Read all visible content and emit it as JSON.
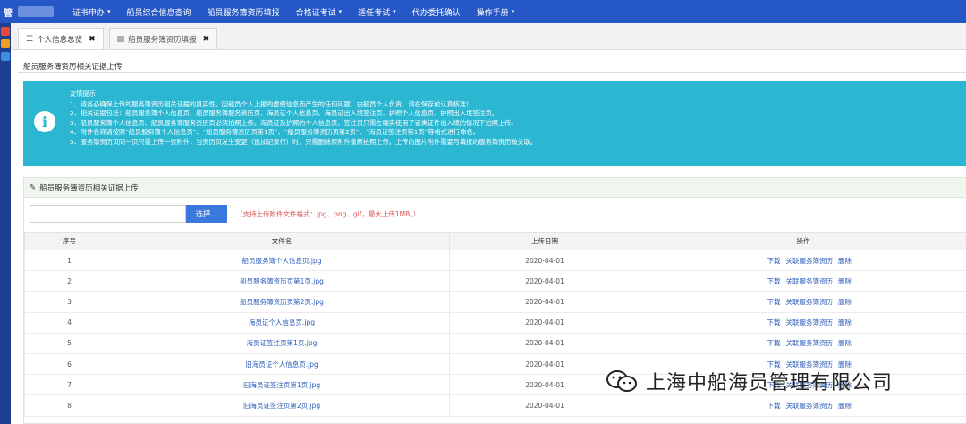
{
  "topbar": {
    "brand_char": "管",
    "nav": [
      {
        "label": "证书申办",
        "dropdown": true
      },
      {
        "label": "船员综合信息查询",
        "dropdown": false
      },
      {
        "label": "船员服务簿资历填报",
        "dropdown": false
      },
      {
        "label": "合格证考试",
        "dropdown": true
      },
      {
        "label": "适任考试",
        "dropdown": true
      },
      {
        "label": "代办委托确认",
        "dropdown": false
      },
      {
        "label": "操作手册",
        "dropdown": true
      }
    ]
  },
  "tabs": [
    {
      "label": "个人信息总览",
      "icon": "list-icon"
    },
    {
      "label": "船员服务簿资历填报",
      "icon": "form-icon"
    }
  ],
  "page": {
    "title": "船员服务簿资历相关证据上传",
    "tips_head": "友情提示：",
    "tips": [
      "1、请务必确保上传的服务簿资历相关证据的真实性，因船员个人上报的虚假信息而产生的任何问题，由船员个人负责，请在保存前认真核准！",
      "2、相关证据包括：船员服务簿个人信息页、船员服务簿服务资历页、海员证个人信息页、海员证出入境签注页、护照个人信息页、护照出入境签注页。",
      "3、船员服务簿个人信息页、船员服务簿服务资历页必须拍照上传。海员证及护照的个人信息页、签注页只需在确实使用了该类证件出入境的情况下拍照上传。",
      "4、附件名称请按照“船员服务簿个人信息页”、“船员服务簿资历页第1页”、“船员服务簿资历页第2页”、“海员证签注页第1页”等格式进行命名。",
      "5、服务簿资历页同一页只需上传一张附件，当资历页发生变更（追加记录行）时，只需删除原附件重新拍照上传。上传的图片附件需要与填报的服务簿资历做关联。"
    ]
  },
  "upload": {
    "panel_title": "船员服务簿资历相关证据上传",
    "choose_label": "选择...",
    "hint": "（支持上传附件文件格式：jpg、png、gif，最大上传1MB。）"
  },
  "table": {
    "headers": [
      "序号",
      "文件名",
      "上传日期",
      "操作"
    ],
    "actions": [
      "下载",
      "关联服务簿资历",
      "删除"
    ],
    "rows": [
      {
        "no": "1",
        "name": "船员服务簿个人信息页.jpg",
        "date": "2020-04-01"
      },
      {
        "no": "2",
        "name": "船员服务簿资历页第1页.jpg",
        "date": "2020-04-01"
      },
      {
        "no": "3",
        "name": "船员服务簿资历页第2页.jpg",
        "date": "2020-04-01"
      },
      {
        "no": "4",
        "name": "海员证个人信息页.jpg",
        "date": "2020-04-01"
      },
      {
        "no": "5",
        "name": "海员证签注页第1页.jpg",
        "date": "2020-04-01"
      },
      {
        "no": "6",
        "name": "旧海员证个人信息页.jpg",
        "date": "2020-04-01"
      },
      {
        "no": "7",
        "name": "旧海员证签注页第1页.jpg",
        "date": "2020-04-01"
      },
      {
        "no": "8",
        "name": "旧海员证签注页第2页.jpg",
        "date": "2020-04-01"
      }
    ]
  },
  "watermark": {
    "text": "上海中船海员管理有限公司"
  }
}
